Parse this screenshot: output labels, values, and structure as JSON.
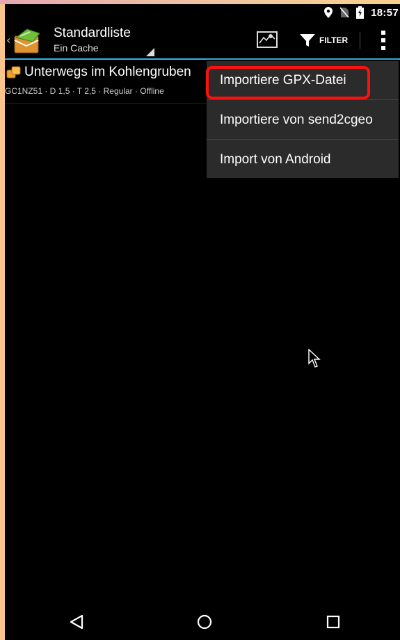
{
  "status_bar": {
    "time": "18:57",
    "icons": [
      "location-pin-icon",
      "no-sim-icon",
      "battery-charging-icon"
    ]
  },
  "action_bar": {
    "title": "Standardliste",
    "subtitle": "Ein Cache",
    "filter_label": "FILTER",
    "accent_color": "#33b5e5"
  },
  "list": {
    "items": [
      {
        "name": "Unterwegs im Kohlengruben",
        "meta": "GC1NZ51 · D 1,5 · T 2,5 · Regular · Offline"
      }
    ]
  },
  "menu": {
    "items": [
      {
        "label": "Importiere GPX-Datei",
        "highlighted": true
      },
      {
        "label": "Importiere von send2cgeo",
        "highlighted": false
      },
      {
        "label": "Import von Android",
        "highlighted": false
      }
    ],
    "highlight_color": "#ff1010"
  },
  "nav_bar": {
    "icons": [
      "back-icon",
      "home-icon",
      "recent-apps-icon"
    ]
  }
}
